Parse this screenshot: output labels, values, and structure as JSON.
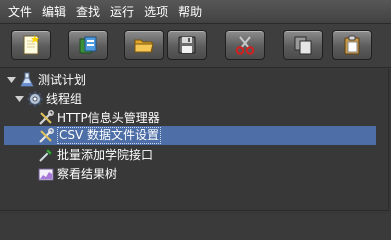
{
  "menubar": {
    "items": [
      {
        "label": "文件"
      },
      {
        "label": "编辑"
      },
      {
        "label": "查找"
      },
      {
        "label": "运行"
      },
      {
        "label": "选项"
      },
      {
        "label": "帮助"
      }
    ]
  },
  "toolbar": {
    "buttons": [
      {
        "icon": "new-document-icon"
      },
      {
        "icon": "templates-icon"
      },
      {
        "icon": "open-folder-icon"
      },
      {
        "icon": "save-disk-icon"
      },
      {
        "icon": "cut-scissors-icon"
      },
      {
        "icon": "copy-icon"
      },
      {
        "icon": "paste-icon"
      }
    ]
  },
  "tree": {
    "nodes": [
      {
        "label": "测试计划",
        "icon": "test-plan-flask-icon",
        "expanded": true
      },
      {
        "label": "线程组",
        "icon": "thread-group-gear-icon",
        "expanded": true
      },
      {
        "label": "HTTP信息头管理器",
        "icon": "config-wrench-icon"
      },
      {
        "label": "CSV 数据文件设置",
        "icon": "config-wrench-icon",
        "selected": true
      },
      {
        "label": "批量添加学院接口",
        "icon": "sampler-pipette-icon"
      },
      {
        "label": "察看结果树",
        "icon": "listener-chart-icon"
      }
    ]
  },
  "colors": {
    "background": "#3a3a3a",
    "selection": "#4d6ea6",
    "text": "#ffffff"
  }
}
